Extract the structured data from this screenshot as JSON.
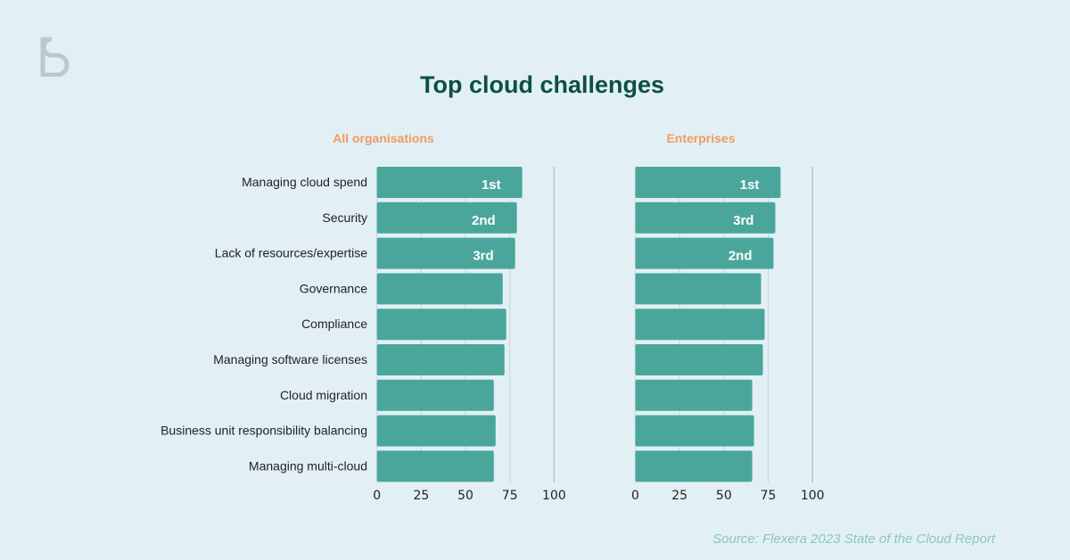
{
  "title": "Top cloud challenges",
  "source": "Source: Flexera 2023 State of the Cloud Report",
  "colors": {
    "bar": "#4aa69a",
    "title": "#0d5045",
    "subtitle": "#f29a5e",
    "source": "#8cc6c2"
  },
  "logo": "BS",
  "chart_data": [
    {
      "type": "bar",
      "orientation": "horizontal",
      "title": "All organisations",
      "xlim": [
        0,
        100
      ],
      "xticks": [
        0,
        25,
        50,
        75,
        100
      ],
      "categories": [
        "Managing cloud spend",
        "Security",
        "Lack of resources/expertise",
        "Governance",
        "Compliance",
        "Managing software licenses",
        "Cloud migration",
        "Business unit responsibility balancing",
        "Managing multi-cloud"
      ],
      "values": [
        82,
        79,
        78,
        71,
        73,
        72,
        66,
        67,
        66
      ],
      "labels": [
        "1st",
        "2nd",
        "3rd",
        "",
        "",
        "",
        "",
        "",
        ""
      ]
    },
    {
      "type": "bar",
      "orientation": "horizontal",
      "title": "Enterprises",
      "xlim": [
        0,
        100
      ],
      "xticks": [
        0,
        25,
        50,
        75,
        100
      ],
      "categories": [
        "Managing cloud spend",
        "Security",
        "Lack of resources/expertise",
        "Governance",
        "Compliance",
        "Managing software licenses",
        "Cloud migration",
        "Business unit responsibility balancing",
        "Managing multi-cloud"
      ],
      "values": [
        82,
        79,
        78,
        71,
        73,
        72,
        66,
        67,
        66
      ],
      "labels": [
        "1st",
        "3rd",
        "2nd",
        "",
        "",
        "",
        "",
        "",
        ""
      ]
    }
  ]
}
